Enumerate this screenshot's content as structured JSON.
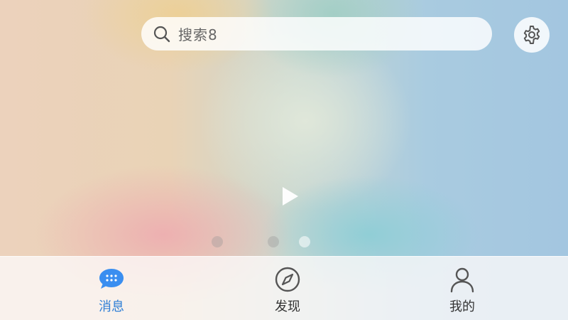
{
  "search": {
    "text": "搜索8"
  },
  "dots": {
    "count": 3,
    "active_index": 2
  },
  "tabs": [
    {
      "label": "消息",
      "icon": "chat-bubble-icon",
      "active": true
    },
    {
      "label": "发现",
      "icon": "compass-icon",
      "active": false
    },
    {
      "label": "我的",
      "icon": "person-icon",
      "active": false
    }
  ],
  "colors": {
    "accent": "#2f7fd6",
    "chat_icon": "#3a8ef0",
    "icon_gray": "#555555"
  },
  "icons": {
    "search": "search-icon",
    "settings": "gear-icon",
    "play": "play-icon"
  }
}
